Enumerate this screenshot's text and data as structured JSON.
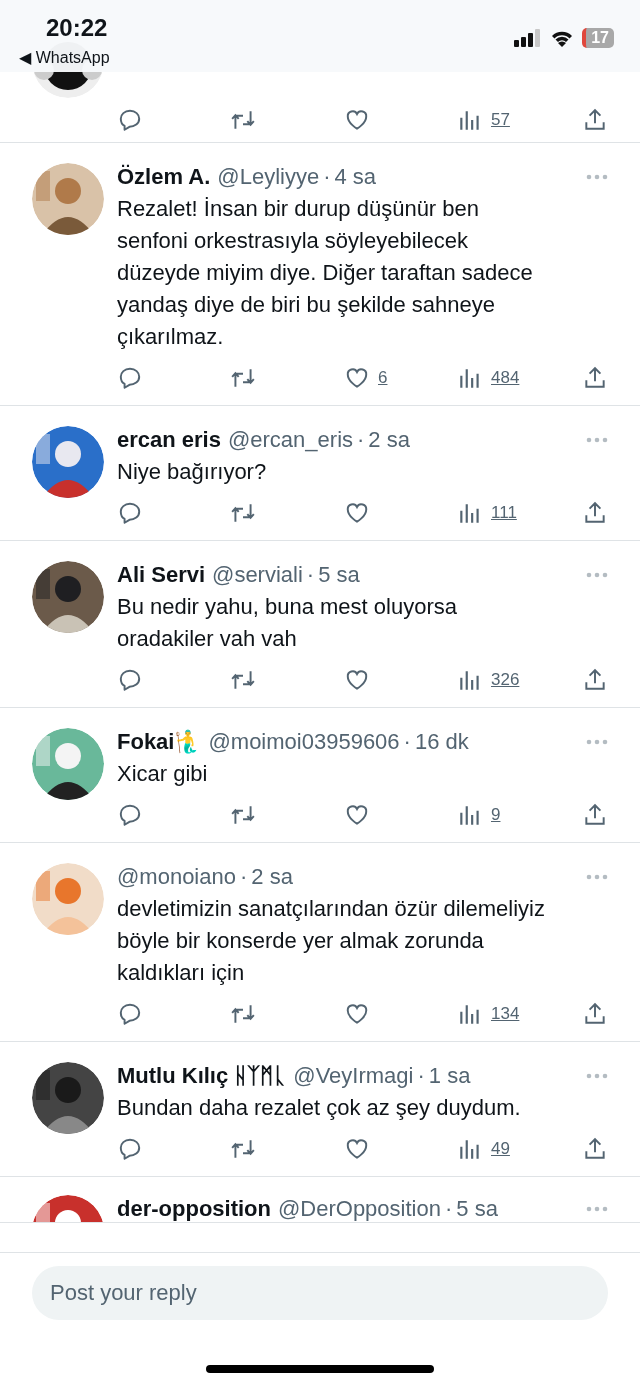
{
  "status_bar": {
    "time": "20:22",
    "back_app": "◀ WhatsApp",
    "battery": "17"
  },
  "top_reply": {
    "views": "57"
  },
  "replies": [
    {
      "name": "Özlem A.",
      "handle": "@Leyliyye",
      "sep": "·",
      "time": "4 sa",
      "lines": [
        "Rezalet! İnsan bir durup düşünür ben",
        "senfoni orkestrasıyla söyleyebilecek",
        "düzeyde miyim diye. Diğer taraftan sadece",
        "yandaş diye de biri bu şekilde sahneye",
        "çıkarılmaz."
      ],
      "likes": "6",
      "views": "484"
    },
    {
      "name": "ercan eris",
      "handle": "@ercan_eris",
      "sep": "·",
      "time": "2 sa",
      "lines": [
        "Niye bağırıyor?"
      ],
      "views": "111"
    },
    {
      "name": "Ali Servi",
      "handle": "@serviali",
      "sep": "·",
      "time": "5 sa",
      "lines": [
        "Bu nedir yahu, buna mest oluyorsa",
        "oradakiler vah vah"
      ],
      "views": "326"
    },
    {
      "name": "Fokai🧜‍♂️",
      "handle": "@moimoi03959606",
      "sep": "·",
      "time": "16 dk",
      "lines": [
        "Xicar gibi"
      ],
      "views": "9"
    },
    {
      "handle": "@monoiano",
      "sep": "·",
      "time": "2 sa",
      "lines": [
        "devletimizin sanatçılarından özür dilemeliyiz",
        "böyle bir konserde yer almak zorunda",
        "kaldıkları için"
      ],
      "views": "134"
    },
    {
      "name": "Mutlu Kılıç ᚺᛉᛗᚳ",
      "handle": "@VeyIrmagi",
      "sep": "·",
      "time": "1 sa",
      "lines": [
        "Bundan daha rezalet çok az şey duydum."
      ],
      "views": "49"
    },
    {
      "name": "der-opposition",
      "handle": "@DerOpposition",
      "sep": "·",
      "time": "5 sa",
      "partial": true
    }
  ],
  "reply_bar": {
    "placeholder": "Post your reply"
  }
}
